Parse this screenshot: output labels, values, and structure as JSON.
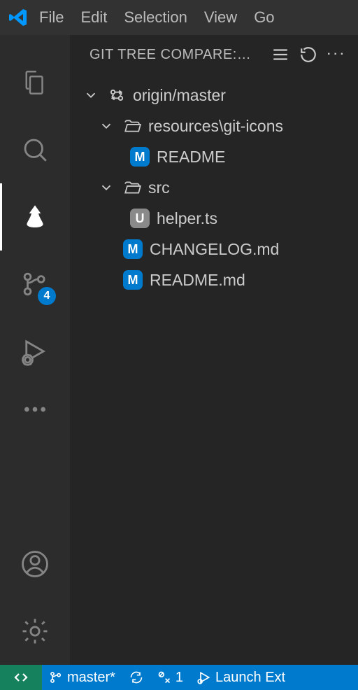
{
  "menubar": {
    "items": [
      "File",
      "Edit",
      "Selection",
      "View",
      "Go"
    ]
  },
  "activityBar": {
    "scmBadge": "4"
  },
  "sidebar": {
    "title": "GIT TREE COMPARE:…"
  },
  "tree": {
    "root": "origin/master",
    "folders": [
      {
        "name": "resources\\git-icons",
        "children": [
          {
            "name": "README",
            "badge": "M",
            "state": "modified"
          }
        ]
      },
      {
        "name": "src",
        "children": [
          {
            "name": "helper.ts",
            "badge": "U",
            "state": "untracked"
          }
        ]
      }
    ],
    "rootFiles": [
      {
        "name": "CHANGELOG.md",
        "badge": "M",
        "state": "modified"
      },
      {
        "name": "README.md",
        "badge": "M",
        "state": "modified"
      }
    ]
  },
  "statusBar": {
    "branch": "master*",
    "problems": "1",
    "launch": "Launch Ext"
  }
}
